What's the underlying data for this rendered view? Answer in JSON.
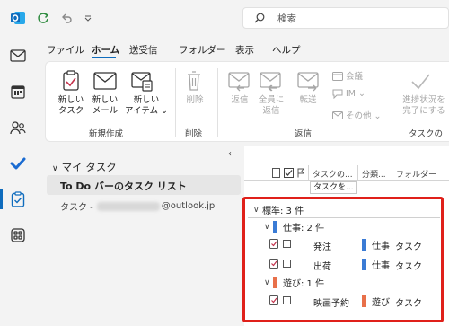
{
  "app": {
    "title_search_placeholder": "検索"
  },
  "menu": {
    "tabs": [
      "ファイル",
      "ホーム",
      "送受信",
      "フォルダー",
      "表示",
      "ヘルプ"
    ],
    "active_tab": "ホーム"
  },
  "ribbon": {
    "groups": {
      "new": {
        "label": "新規作成",
        "buttons": [
          {
            "line1": "新しい",
            "line2": "タスク"
          },
          {
            "line1": "新しい",
            "line2": "メール"
          },
          {
            "line1": "新しい",
            "line2": "アイテム ⌄"
          }
        ]
      },
      "delete": {
        "label": "削除",
        "button": "削除"
      },
      "respond": {
        "label": "返信",
        "buttons": [
          {
            "line1": "返信",
            "line2": ""
          },
          {
            "line1": "全員に",
            "line2": "返信"
          },
          {
            "line1": "転送",
            "line2": ""
          }
        ],
        "small": [
          "会議",
          "IM ⌄",
          "その他 ⌄"
        ]
      },
      "manage": {
        "label": "タスクの",
        "button": {
          "line1": "進捗状況を",
          "line2": "完了にする"
        }
      }
    }
  },
  "folder_pane": {
    "section": "マイ タスク",
    "item": "To Do バーのタスク リスト",
    "account_prefix": "タスク - ",
    "account_suffix": "@outlook.jp"
  },
  "list": {
    "columns": [
      "タスクの...",
      "分類...",
      "フォルダー"
    ],
    "new_task_placeholder": "タスクを...",
    "groups": [
      {
        "label": "標準: 3 件",
        "subgroups": [
          {
            "label": "仕事: 2 件",
            "color": "#3a7bd5",
            "rows": [
              {
                "subject": "発注",
                "category": "仕事",
                "folder": "タスク"
              },
              {
                "subject": "出荷",
                "category": "仕事",
                "folder": "タスク"
              }
            ]
          },
          {
            "label": "遊び: 1 件",
            "color": "#e8704a",
            "rows": [
              {
                "subject": "映画予約",
                "category": "遊び",
                "folder": "タスク"
              }
            ]
          }
        ]
      }
    ]
  },
  "colors": {
    "accent": "#0f6cbd",
    "highlight": "#e0201a",
    "work": "#3a7bd5",
    "play": "#e8704a"
  },
  "icons": [
    "outlook-icon",
    "refresh-icon",
    "undo-icon",
    "dropdown-icon",
    "search-icon",
    "mail-icon",
    "calendar-icon",
    "people-icon",
    "todo-icon",
    "tasks-icon",
    "apps-icon"
  ]
}
